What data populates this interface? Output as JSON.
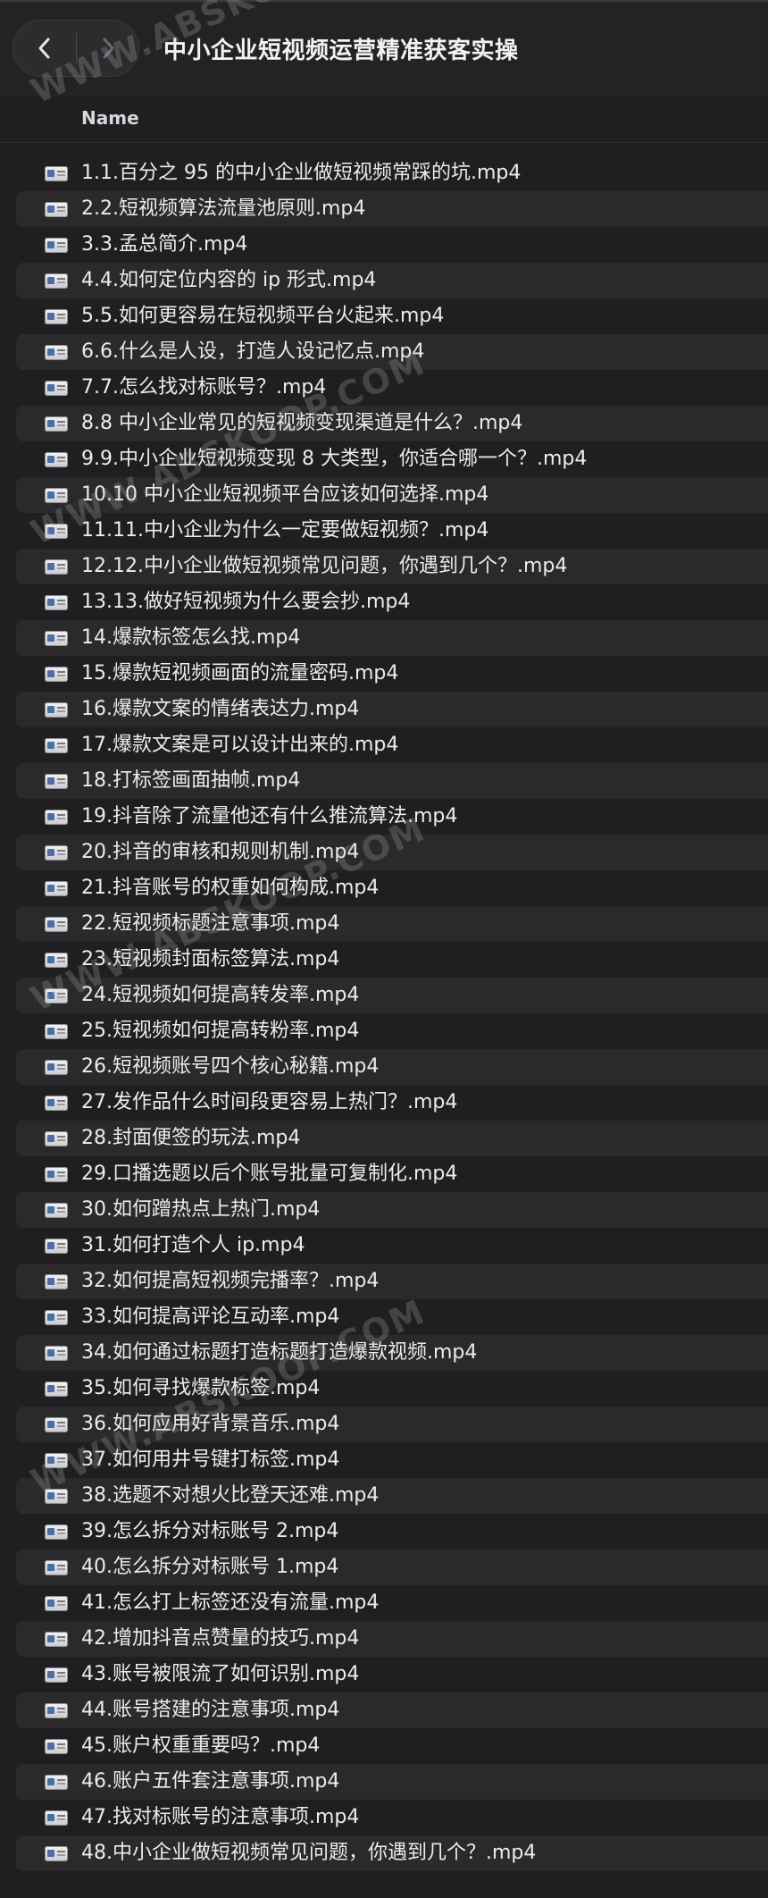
{
  "window": {
    "title": "中小企业短视频运营精准获客实操"
  },
  "nav": {
    "back_icon": "chevron-left-icon",
    "forward_icon": "chevron-right-icon"
  },
  "columns": {
    "name": "Name"
  },
  "watermark": {
    "text": "WWW.ABSKOOP.COM"
  },
  "colors": {
    "background": "#1f1f21",
    "row_alt": "#2a2a2c",
    "text": "#ececef"
  },
  "files": [
    "1.1.百分之 95 的中小企业做短视频常踩的坑.mp4",
    "2.2.短视频算法流量池原则.mp4",
    "3.3.孟总简介.mp4",
    "4.4.如何定位内容的 ip 形式.mp4",
    "5.5.如何更容易在短视频平台火起来.mp4",
    "6.6.什么是人设，打造人设记忆点.mp4",
    "7.7.怎么找对标账号？.mp4",
    "8.8 中小企业常见的短视频变现渠道是什么？.mp4",
    "9.9.中小企业短视频变现 8 大类型，你适合哪一个？.mp4",
    "10.10 中小企业短视频平台应该如何选择.mp4",
    "11.11.中小企业为什么一定要做短视频？.mp4",
    "12.12.中小企业做短视频常见问题，你遇到几个？.mp4",
    "13.13.做好短视频为什么要会抄.mp4",
    "14.爆款标签怎么找.mp4",
    "15.爆款短视频画面的流量密码.mp4",
    "16.爆款文案的情绪表达力.mp4",
    "17.爆款文案是可以设计出来的.mp4",
    "18.打标签画面抽帧.mp4",
    "19.抖音除了流量他还有什么推流算法.mp4",
    "20.抖音的审核和规则机制.mp4",
    "21.抖音账号的权重如何构成.mp4",
    "22.短视频标题注意事项.mp4",
    "23.短视频封面标签算法.mp4",
    "24.短视频如何提高转发率.mp4",
    "25.短视频如何提高转粉率.mp4",
    "26.短视频账号四个核心秘籍.mp4",
    "27.发作品什么时间段更容易上热门？.mp4",
    "28.封面便签的玩法.mp4",
    "29.口播选题以后个账号批量可复制化.mp4",
    "30.如何蹭热点上热门.mp4",
    "31.如何打造个人 ip.mp4",
    "32.如何提高短视频完播率？.mp4",
    "33.如何提高评论互动率.mp4",
    "34.如何通过标题打造标题打造爆款视频.mp4",
    "35.如何寻找爆款标签.mp4",
    "36.如何应用好背景音乐.mp4",
    "37.如何用井号键打标签.mp4",
    "38.选题不对想火比登天还难.mp4",
    "39.怎么拆分对标账号 2.mp4",
    "40.怎么拆分对标账号 1.mp4",
    "41.怎么打上标签还没有流量.mp4",
    "42.增加抖音点赞量的技巧.mp4",
    "43.账号被限流了如何识别.mp4",
    "44.账号搭建的注意事项.mp4",
    "45.账户权重重要吗？.mp4",
    "46.账户五件套注意事项.mp4",
    "47.找对标账号的注意事项.mp4",
    "48.中小企业做短视频常见问题，你遇到几个？.mp4"
  ]
}
